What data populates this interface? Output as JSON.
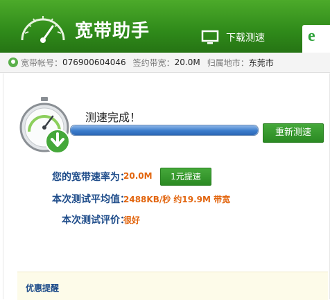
{
  "header": {
    "title": "宽带助手",
    "nav_download_test": "下载测速",
    "ie_glyph": "e"
  },
  "info": {
    "account_label": "宽带帐号：",
    "account_value": "076900604046",
    "bandwidth_label": "签约带宽：",
    "bandwidth_value": "20.0M",
    "location_label": "归属地市：",
    "location_value": "东莞市"
  },
  "test": {
    "status": "测速完成！",
    "progress_fraction": 1.0,
    "retest_button": "重新测速"
  },
  "results": {
    "rate_label": "您的宽带速率为：",
    "rate_value": "20.0M",
    "boost_button": "1元提速",
    "avg_label": "本次测试平均值：",
    "avg_value": "2488KB/秒 约19.9M 带宽",
    "eval_label": "本次测试评价：",
    "eval_value": "很好"
  },
  "promo": {
    "title": "优惠提醒"
  },
  "colors": {
    "header_green": "#2f8a1a",
    "label_blue": "#1e4c8a",
    "value_orange": "#e2650e"
  }
}
